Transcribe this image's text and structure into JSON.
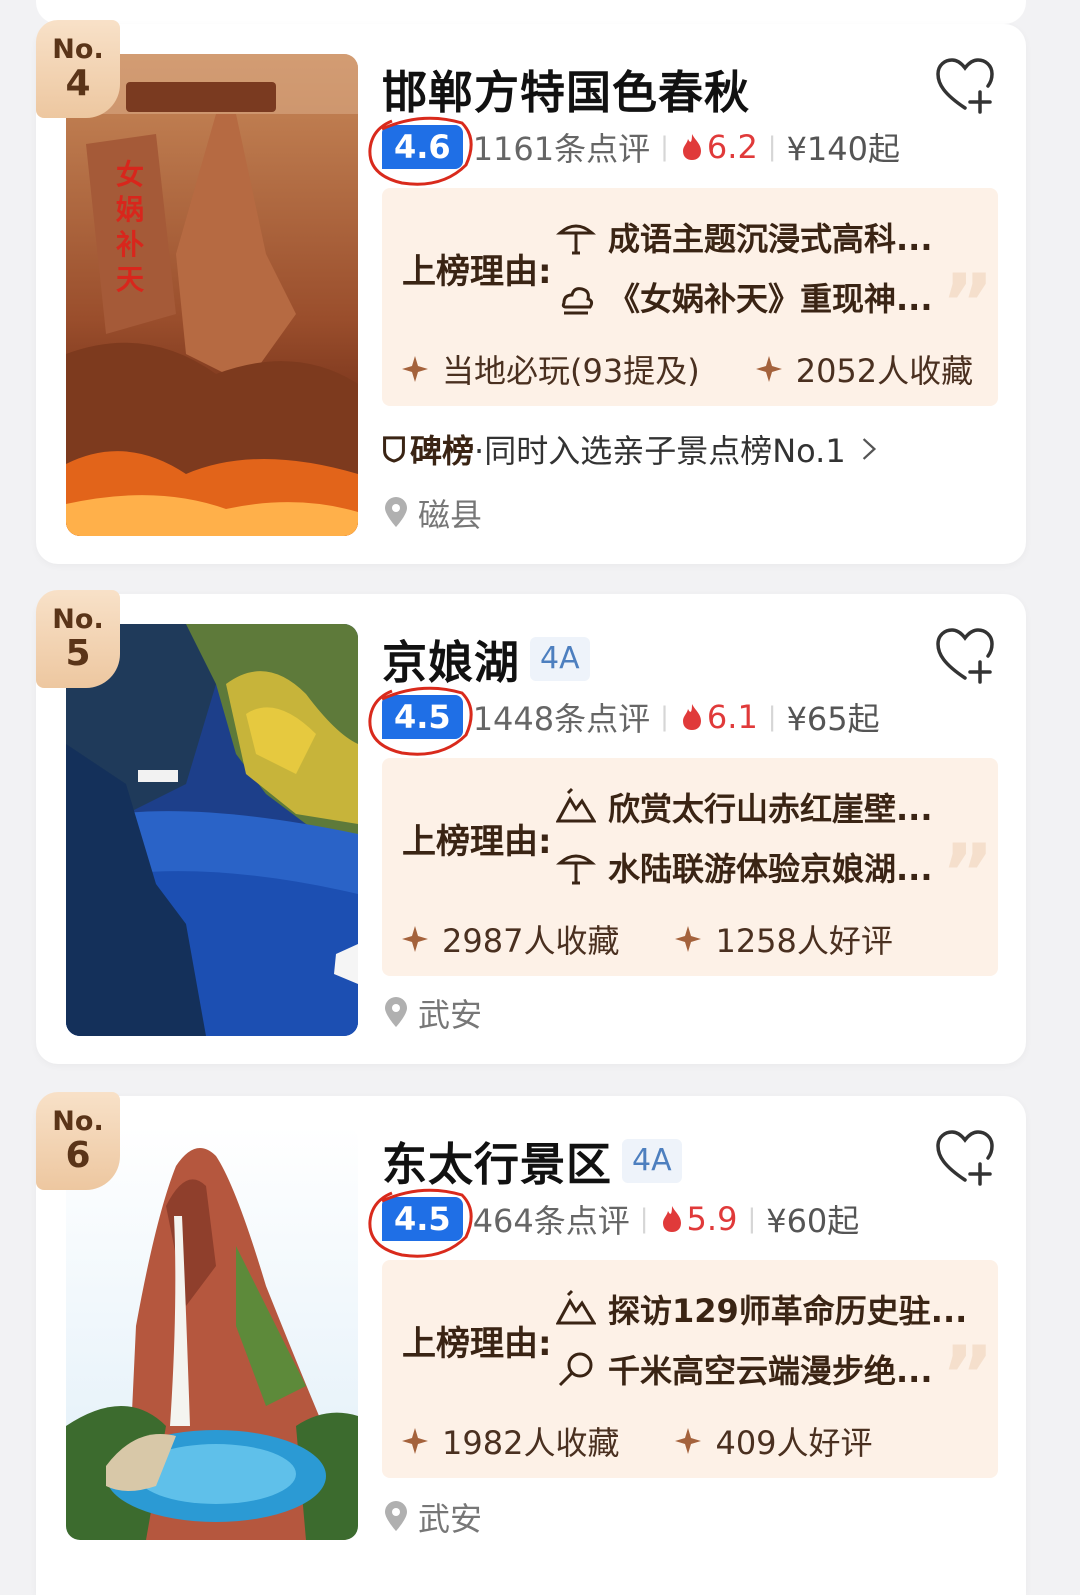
{
  "colors": {
    "score_blue": "#1f6fe6",
    "heat_red": "#e03a3a",
    "reason_bg": "#fdf1e7",
    "badge_gold": "#edc7a0"
  },
  "items": [
    {
      "rank_prefix": "No.",
      "rank": "4",
      "name": "邯郸方特国色春秋",
      "level": "",
      "score": "4.6",
      "reviews": "1161条点评",
      "heat": "6.2",
      "price": "¥140起",
      "reason_label": "上榜理由:",
      "reasons": [
        {
          "icon": "parasol-icon",
          "text": "成语主题沉浸式高科..."
        },
        {
          "icon": "sun-cloud-icon",
          "text": "《女娲补天》重现神..."
        }
      ],
      "stats": [
        "当地必玩(93提及)",
        "2052人收藏"
      ],
      "board_label": "碑榜",
      "board_text": "·同时入选亲子景点榜No.1",
      "location": "磁县"
    },
    {
      "rank_prefix": "No.",
      "rank": "5",
      "name": "京娘湖",
      "level": "4A",
      "score": "4.5",
      "reviews": "1448条点评",
      "heat": "6.1",
      "price": "¥65起",
      "reason_label": "上榜理由:",
      "reasons": [
        {
          "icon": "mountain-icon",
          "text": "欣赏太行山赤红崖壁..."
        },
        {
          "icon": "parasol-icon",
          "text": "水陆联游体验京娘湖..."
        }
      ],
      "stats": [
        "2987人收藏",
        "1258人好评"
      ],
      "location": "武安"
    },
    {
      "rank_prefix": "No.",
      "rank": "6",
      "name": "东太行景区",
      "level": "4A",
      "score": "4.5",
      "reviews": "464条点评",
      "heat": "5.9",
      "price": "¥60起",
      "reason_label": "上榜理由:",
      "reasons": [
        {
          "icon": "mountain-icon",
          "text": "探访129师革命历史驻..."
        },
        {
          "icon": "magnifier-icon",
          "text": "千米高空云端漫步绝..."
        }
      ],
      "stats": [
        "1982人收藏",
        "409人好评"
      ],
      "location": "武安"
    }
  ]
}
